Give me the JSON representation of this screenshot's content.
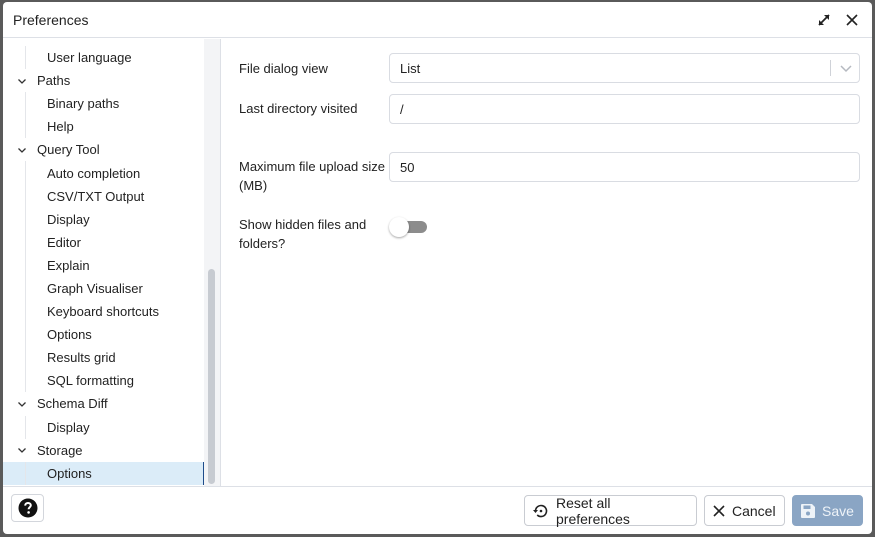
{
  "dialog": {
    "title": "Preferences",
    "maximize_icon": "expand-arrows-icon",
    "close_icon": "close-icon"
  },
  "tree": {
    "items": [
      {
        "label": "User language",
        "level": "child"
      },
      {
        "label": "Paths",
        "level": "parent",
        "expanded": true
      },
      {
        "label": "Binary paths",
        "level": "child"
      },
      {
        "label": "Help",
        "level": "child"
      },
      {
        "label": "Query Tool",
        "level": "parent",
        "expanded": true
      },
      {
        "label": "Auto completion",
        "level": "child"
      },
      {
        "label": "CSV/TXT Output",
        "level": "child"
      },
      {
        "label": "Display",
        "level": "child"
      },
      {
        "label": "Editor",
        "level": "child"
      },
      {
        "label": "Explain",
        "level": "child"
      },
      {
        "label": "Graph Visualiser",
        "level": "child"
      },
      {
        "label": "Keyboard shortcuts",
        "level": "child"
      },
      {
        "label": "Options",
        "level": "child"
      },
      {
        "label": "Results grid",
        "level": "child"
      },
      {
        "label": "SQL formatting",
        "level": "child"
      },
      {
        "label": "Schema Diff",
        "level": "parent",
        "expanded": true
      },
      {
        "label": "Display",
        "level": "child"
      },
      {
        "label": "Storage",
        "level": "parent",
        "expanded": true
      },
      {
        "label": "Options",
        "level": "child",
        "selected": true
      }
    ]
  },
  "form": {
    "file_dialog_view": {
      "label": "File dialog view",
      "value": "List"
    },
    "last_directory": {
      "label": "Last directory visited",
      "value": "/"
    },
    "max_upload": {
      "label": "Maximum file upload size (MB)",
      "value": "50"
    },
    "show_hidden": {
      "label": "Show hidden files and folders?",
      "value": false
    }
  },
  "footer": {
    "help_icon": "question-circle-icon",
    "reset_label": "Reset all preferences",
    "cancel_label": "Cancel",
    "save_label": "Save"
  }
}
